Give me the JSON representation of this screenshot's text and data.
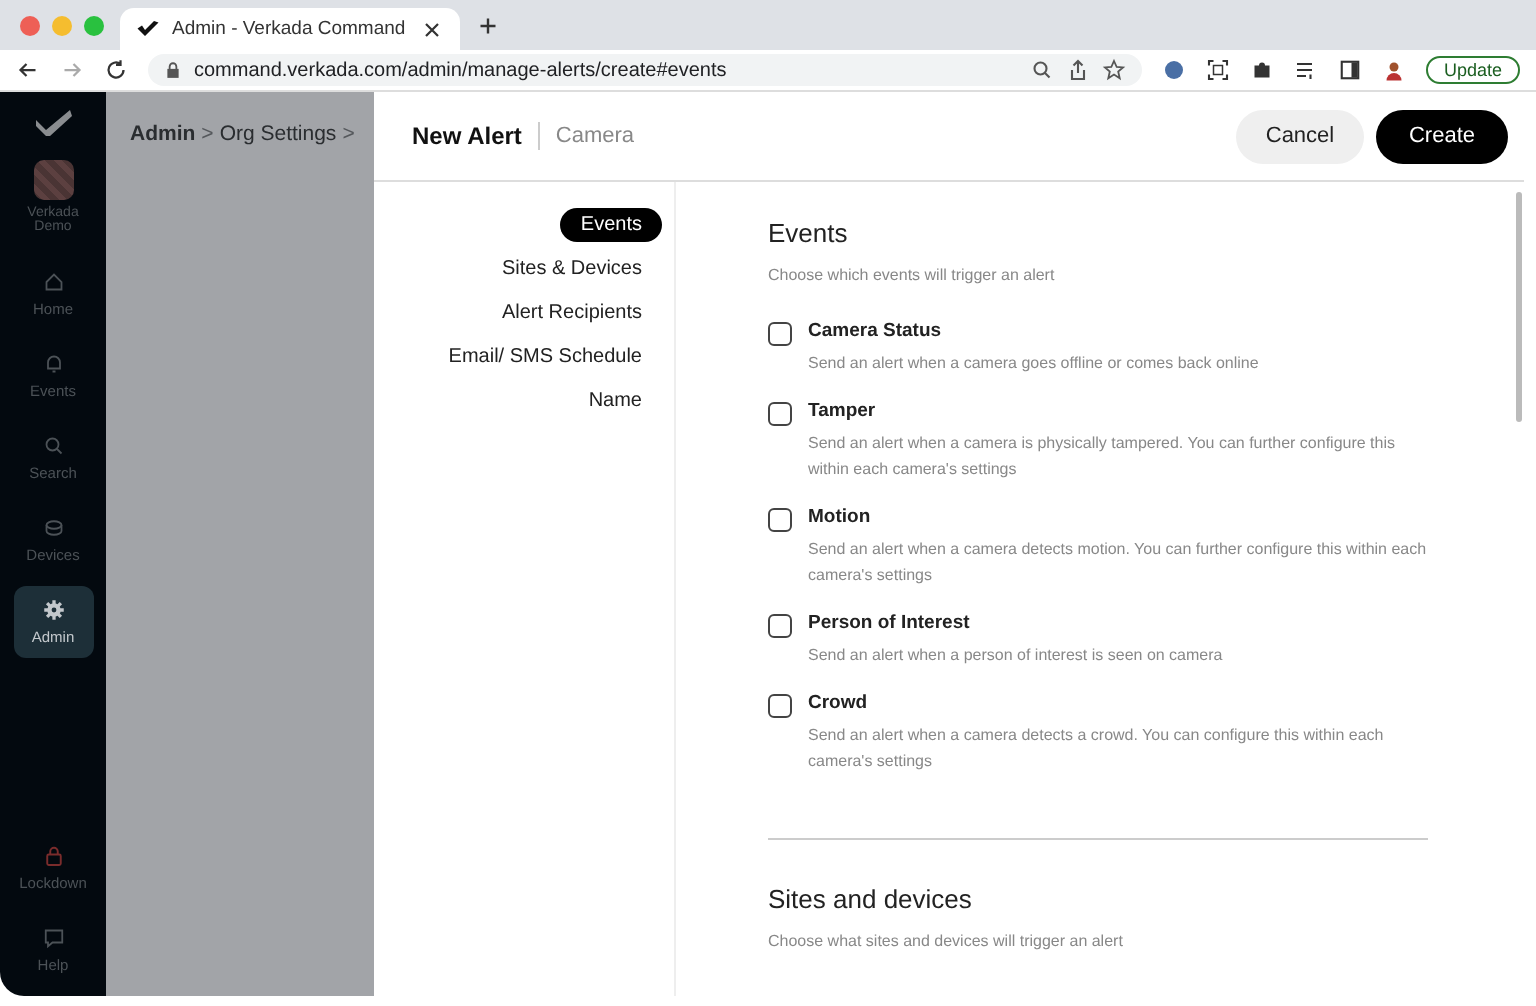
{
  "browser": {
    "tab_title": "Admin - Verkada Command",
    "url": "command.verkada.com/admin/manage-alerts/create#events",
    "update_button": "Update"
  },
  "sidebar": {
    "org_name": "Verkada Demo",
    "items": [
      {
        "label": "Home",
        "selected": false,
        "kind": "nav"
      },
      {
        "label": "Events",
        "selected": false,
        "kind": "nav"
      },
      {
        "label": "Search",
        "selected": false,
        "kind": "nav"
      },
      {
        "label": "Devices",
        "selected": false,
        "kind": "nav"
      },
      {
        "label": "Admin",
        "selected": true,
        "kind": "nav"
      }
    ],
    "bottom_items": [
      {
        "label": "Lockdown",
        "selected": false,
        "kind": "danger"
      },
      {
        "label": "Help",
        "selected": false,
        "kind": "nav"
      }
    ]
  },
  "breadcrumb": [
    "Admin",
    ">",
    "Org Settings",
    ">"
  ],
  "panel": {
    "title": "New Alert",
    "subtitle": "Camera",
    "cancel_button": "Cancel",
    "create_button": "Create",
    "steps": [
      {
        "label": "Events",
        "selected": true
      },
      {
        "label": "Sites & Devices",
        "selected": false
      },
      {
        "label": "Alert Recipients",
        "selected": false
      },
      {
        "label": "Email/ SMS Schedule",
        "selected": false
      },
      {
        "label": "Name",
        "selected": false
      }
    ],
    "sections": [
      {
        "title": "Events",
        "description": "Choose which events will trigger an alert",
        "options": [
          {
            "label": "Camera Status",
            "description": "Send an alert when a camera goes offline or comes back online",
            "checked": false
          },
          {
            "label": "Tamper",
            "description": "Send an alert when a camera is physically tampered. You can further configure this within each camera's settings",
            "checked": false
          },
          {
            "label": "Motion",
            "description": "Send an alert when a camera detects motion. You can further configure this within each camera's settings",
            "checked": false
          },
          {
            "label": "Person of Interest",
            "description": "Send an alert when a person of interest is seen on camera",
            "checked": false
          },
          {
            "label": "Crowd",
            "description": "Send an alert when a camera detects a crowd. You can configure this within each camera's settings",
            "checked": false
          }
        ]
      },
      {
        "title": "Sites and devices",
        "description": "Choose what sites and devices will trigger an alert"
      }
    ]
  }
}
